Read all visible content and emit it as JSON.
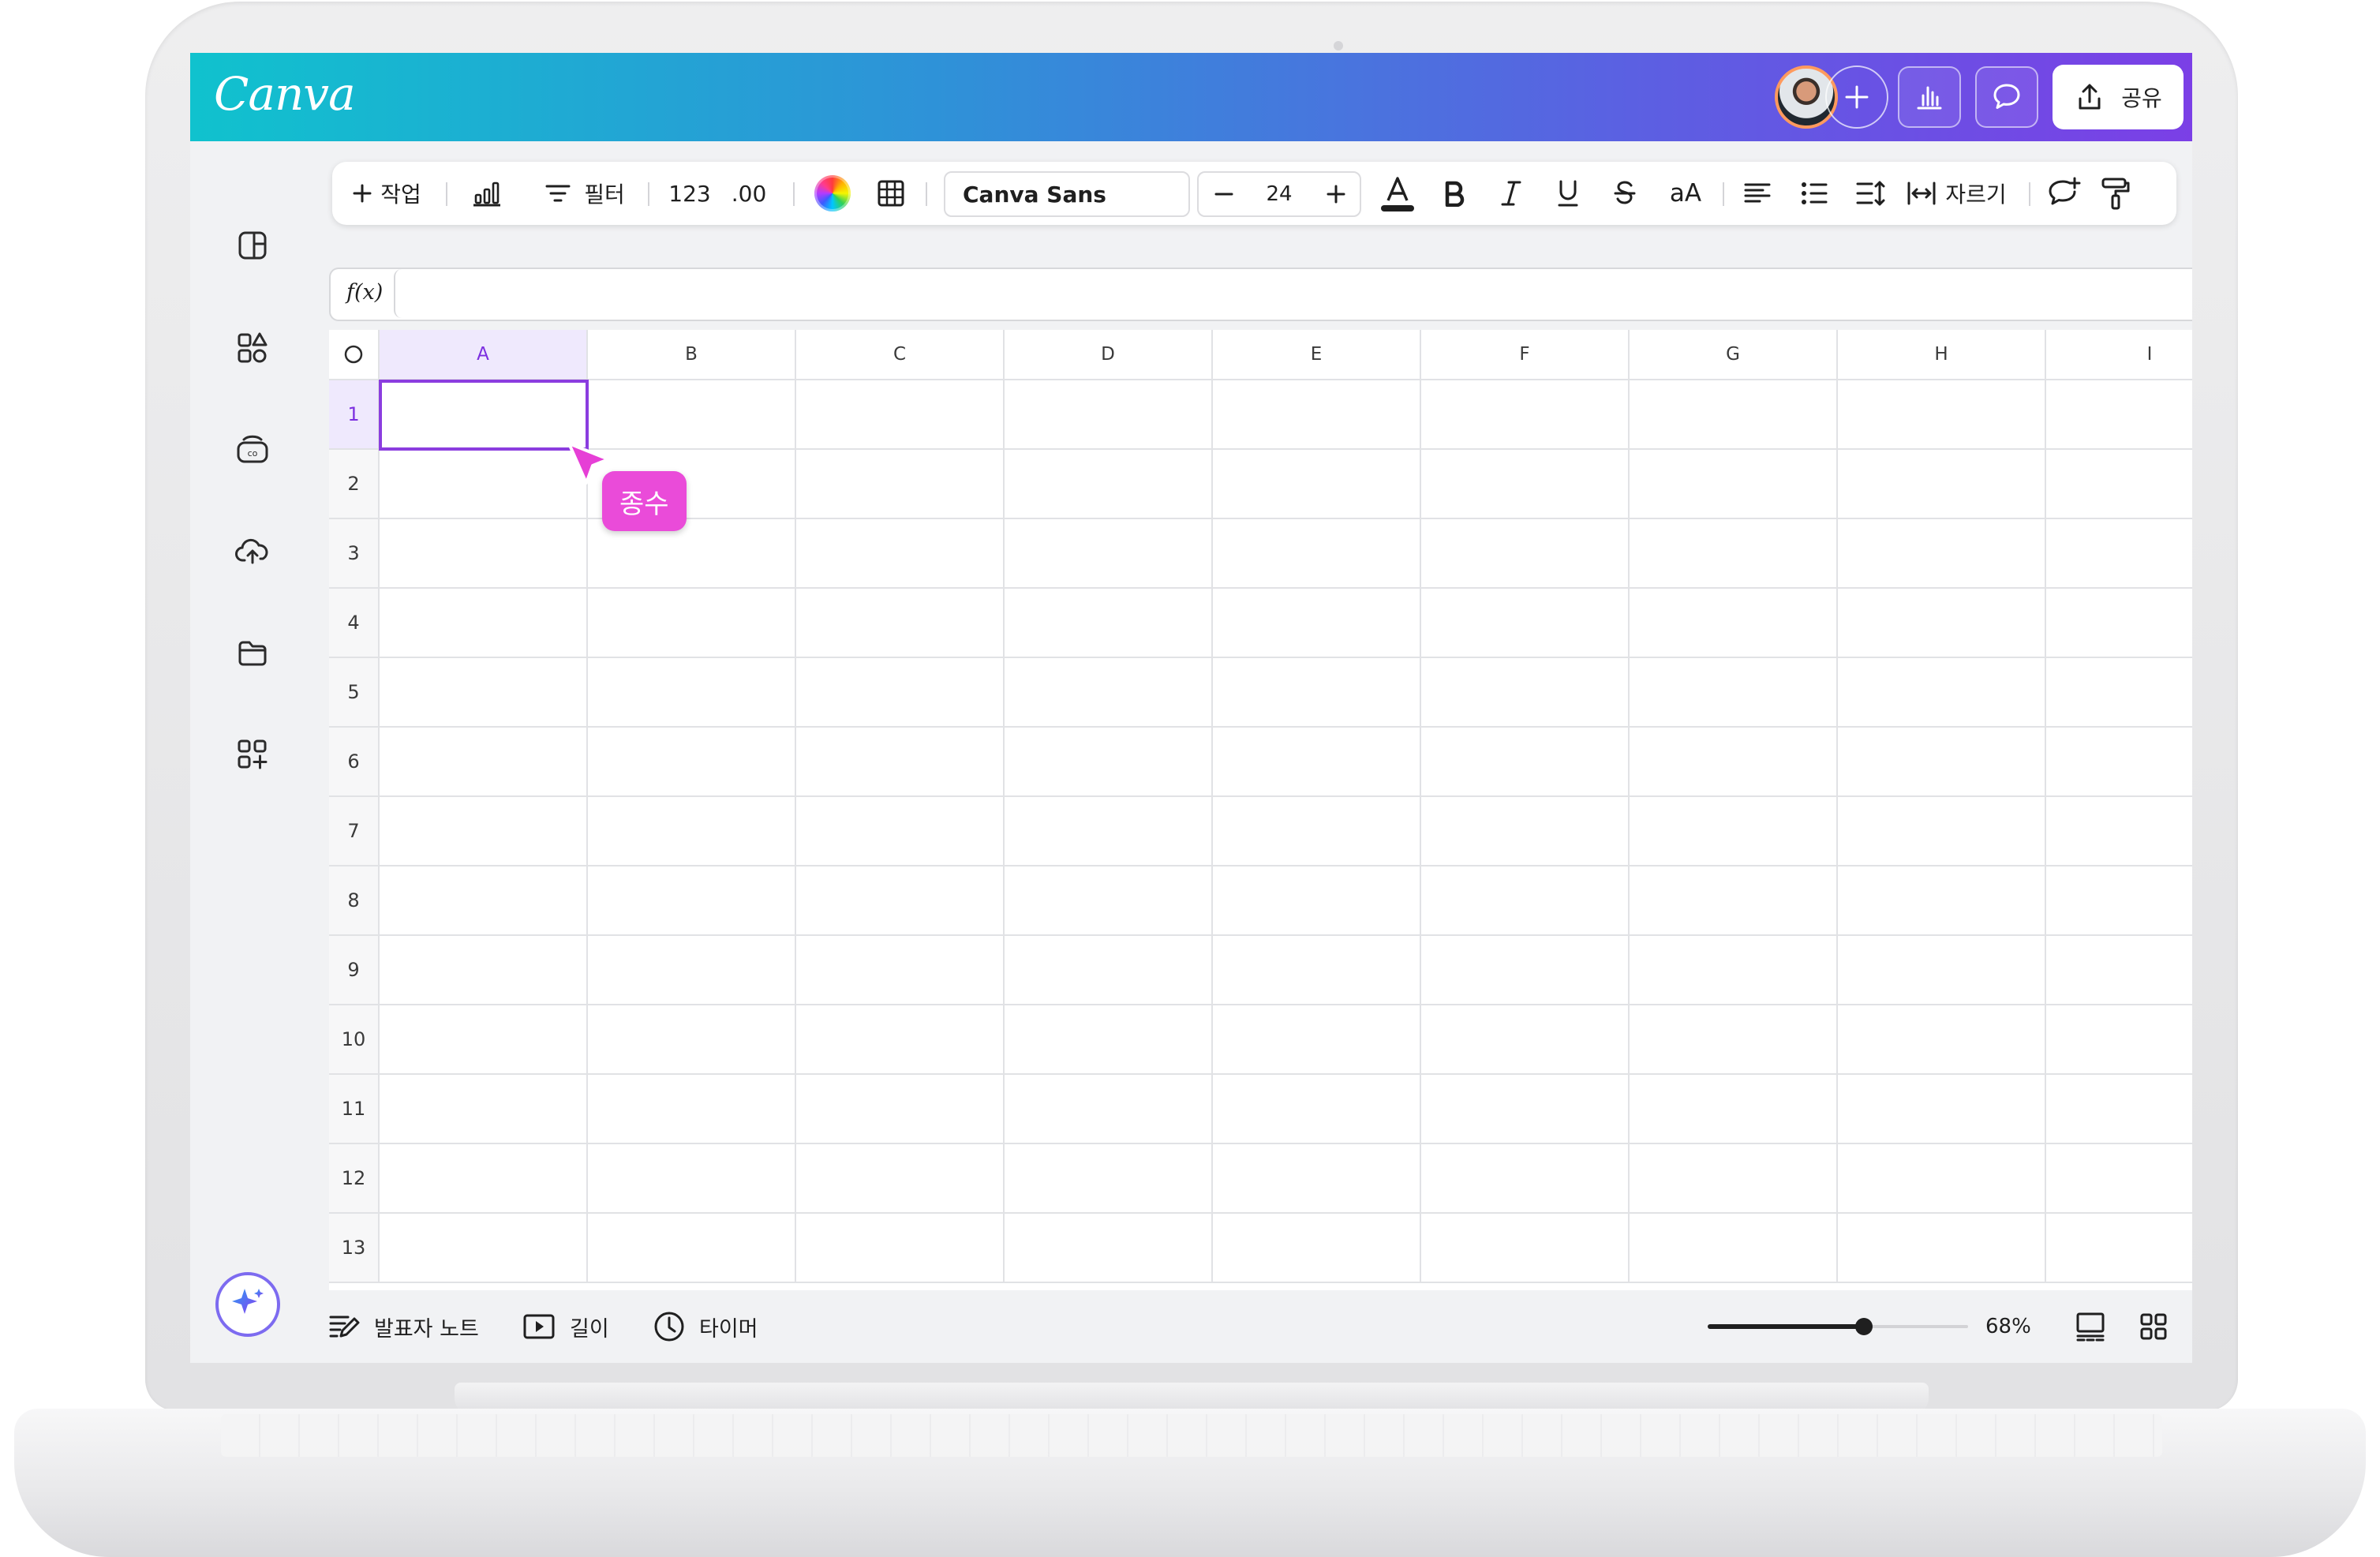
{
  "header": {
    "logo": "Canva",
    "share_label": "공유"
  },
  "toolbar": {
    "action_label": "작업",
    "filter_label": "필터",
    "number_format": "123",
    "decimal_format": ".00",
    "font_family": "Canva Sans",
    "font_size": "24",
    "case_label": "aA",
    "crop_label": "자르기"
  },
  "formula_bar": {
    "label": "f(x)",
    "value": ""
  },
  "sheet": {
    "columns": [
      "A",
      "B",
      "C",
      "D",
      "E",
      "F",
      "G",
      "H",
      "I"
    ],
    "rows": [
      "1",
      "2",
      "3",
      "4",
      "5",
      "6",
      "7",
      "8",
      "9",
      "10",
      "11",
      "12",
      "13"
    ],
    "selected_cell": "A1",
    "accent_color": "#8b3ddf"
  },
  "collaborator": {
    "name": "종수",
    "color": "#ea4bd9"
  },
  "footer": {
    "notes_label": "발표자 노트",
    "duration_label": "길이",
    "timer_label": "타이머",
    "zoom_level": "68%",
    "zoom_fraction": 0.6
  },
  "icons": {
    "rail": [
      "layout-icon",
      "elements-icon",
      "brand-icon",
      "upload-cloud-icon",
      "folder-icon",
      "apps-icon"
    ],
    "magic": "magic-sparkle-icon"
  }
}
